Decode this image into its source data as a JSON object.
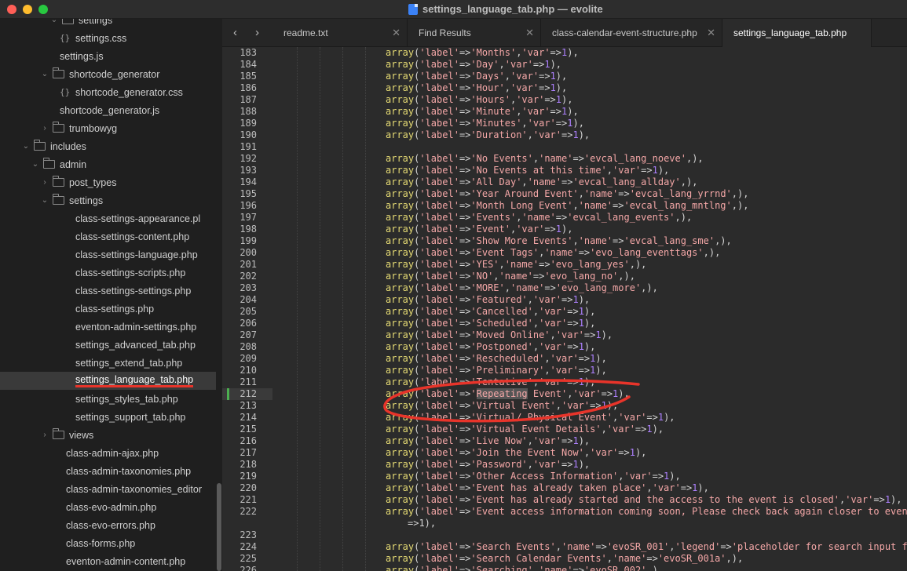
{
  "window": {
    "title": "settings_language_tab.php — evolite",
    "colors": {
      "accent_annotation": "#e8342a",
      "active_file_underline": "#e8342a",
      "modified_marker": "#4caf50"
    }
  },
  "sidebar": {
    "items": [
      {
        "label": "settings",
        "type": "folder",
        "open": true
      },
      {
        "label": "settings.css",
        "type": "css"
      },
      {
        "label": "settings.js",
        "type": "file"
      },
      {
        "label": "shortcode_generator",
        "type": "folder",
        "open": true
      },
      {
        "label": "shortcode_generator.css",
        "type": "css"
      },
      {
        "label": "shortcode_generator.js",
        "type": "file"
      },
      {
        "label": "trumbowyg",
        "type": "folder",
        "open": false
      },
      {
        "label": "includes",
        "type": "folder",
        "open": true
      },
      {
        "label": "admin",
        "type": "folder",
        "open": true
      },
      {
        "label": "post_types",
        "type": "folder",
        "open": false
      },
      {
        "label": "settings",
        "type": "folder",
        "open": true
      },
      {
        "label": "class-settings-appearance.pl",
        "type": "file"
      },
      {
        "label": "class-settings-content.php",
        "type": "file"
      },
      {
        "label": "class-settings-language.php",
        "type": "file"
      },
      {
        "label": "class-settings-scripts.php",
        "type": "file"
      },
      {
        "label": "class-settings-settings.php",
        "type": "file"
      },
      {
        "label": "class-settings.php",
        "type": "file"
      },
      {
        "label": "eventon-admin-settings.php",
        "type": "file"
      },
      {
        "label": "settings_advanced_tab.php",
        "type": "file"
      },
      {
        "label": "settings_extend_tab.php",
        "type": "file"
      },
      {
        "label": "settings_language_tab.php",
        "type": "file",
        "selected": true
      },
      {
        "label": "settings_styles_tab.php",
        "type": "file"
      },
      {
        "label": "settings_support_tab.php",
        "type": "file"
      },
      {
        "label": "views",
        "type": "folder",
        "open": false
      },
      {
        "label": "class-admin-ajax.php",
        "type": "file"
      },
      {
        "label": "class-admin-taxonomies.php",
        "type": "file"
      },
      {
        "label": "class-admin-taxonomies_editor",
        "type": "file"
      },
      {
        "label": "class-evo-admin.php",
        "type": "file"
      },
      {
        "label": "class-evo-errors.php",
        "type": "file"
      },
      {
        "label": "class-forms.php",
        "type": "file"
      },
      {
        "label": "eventon-admin-content.php",
        "type": "file"
      }
    ]
  },
  "tabs": [
    {
      "label": "readme.txt",
      "active": false
    },
    {
      "label": "Find Results",
      "active": false
    },
    {
      "label": "class-calendar-event-structure.php",
      "active": false
    },
    {
      "label": "settings_language_tab.php",
      "active": true
    }
  ],
  "nav": {
    "back": "‹",
    "forward": "›",
    "close": "✕"
  },
  "editor": {
    "current_line": 212,
    "lines": [
      {
        "n": "183",
        "label": "Months",
        "var": "1"
      },
      {
        "n": "184",
        "label": "Day",
        "var": "1"
      },
      {
        "n": "185",
        "label": "Days",
        "var": "1"
      },
      {
        "n": "186",
        "label": "Hour",
        "var": "1"
      },
      {
        "n": "187",
        "label": "Hours",
        "var": "1"
      },
      {
        "n": "188",
        "label": "Minute",
        "var": "1"
      },
      {
        "n": "189",
        "label": "Minutes",
        "var": "1"
      },
      {
        "n": "190",
        "label": "Duration",
        "var": "1"
      },
      {
        "n": "191",
        "blank": true
      },
      {
        "n": "192",
        "label": "No Events",
        "name": "evcal_lang_noeve"
      },
      {
        "n": "193",
        "label": "No Events at this time",
        "var": "1"
      },
      {
        "n": "194",
        "label": "All Day",
        "name": "evcal_lang_allday"
      },
      {
        "n": "195",
        "label": "Year Around Event",
        "name": "evcal_lang_yrrnd"
      },
      {
        "n": "196",
        "label": "Month Long Event",
        "name": "evcal_lang_mntlng"
      },
      {
        "n": "197",
        "label": "Events",
        "name": "evcal_lang_events"
      },
      {
        "n": "198",
        "label": "Event",
        "var": "1"
      },
      {
        "n": "199",
        "label": "Show More Events",
        "name": "evcal_lang_sme"
      },
      {
        "n": "200",
        "label": "Event Tags",
        "name": "evo_lang_eventtags"
      },
      {
        "n": "201",
        "label": "YES",
        "name": "evo_lang_yes"
      },
      {
        "n": "202",
        "label": "NO",
        "name": "evo_lang_no"
      },
      {
        "n": "203",
        "label": "MORE",
        "name": "evo_lang_more"
      },
      {
        "n": "204",
        "label": "Featured",
        "var": "1"
      },
      {
        "n": "205",
        "label": "Cancelled",
        "var": "1"
      },
      {
        "n": "206",
        "label": "Scheduled",
        "var": "1"
      },
      {
        "n": "207",
        "label": "Moved Online",
        "var": "1"
      },
      {
        "n": "208",
        "label": "Postponed",
        "var": "1"
      },
      {
        "n": "209",
        "label": "Rescheduled",
        "var": "1"
      },
      {
        "n": "210",
        "label": "Preliminary",
        "var": "1"
      },
      {
        "n": "211",
        "label": "Tentative",
        "var": "1"
      },
      {
        "n": "212",
        "label": "Repeating Event",
        "var": "1",
        "highlight": "Repeating"
      },
      {
        "n": "213",
        "label": "Virtual Event",
        "var": "1"
      },
      {
        "n": "214",
        "label": "Virtual/ Physical Event",
        "var": "1"
      },
      {
        "n": "215",
        "label": "Virtual Event Details",
        "var": "1"
      },
      {
        "n": "216",
        "label": "Live Now",
        "var": "1"
      },
      {
        "n": "217",
        "label": "Join the Event Now",
        "var": "1"
      },
      {
        "n": "218",
        "label": "Password",
        "var": "1"
      },
      {
        "n": "219",
        "label": "Other Access Information",
        "var": "1"
      },
      {
        "n": "220",
        "label": "Event has already taken place",
        "var": "1"
      },
      {
        "n": "221",
        "label": "Event has already started and the access to the event is closed",
        "var": "1"
      },
      {
        "n": "222",
        "label": "Event access information coming soon, Please check back again closer to event s",
        "wrap": true
      },
      {
        "n": "",
        "cont": "=>1),"
      },
      {
        "n": "223",
        "blank": true
      },
      {
        "n": "224",
        "label": "Search Events",
        "name": "evoSR_001",
        "legend": "placeholder for search input fiel"
      },
      {
        "n": "225",
        "label": "Search Calendar Events",
        "name": "evoSR_001a"
      },
      {
        "n": "226",
        "label": "Searching",
        "name": "evoSR_002"
      }
    ]
  }
}
